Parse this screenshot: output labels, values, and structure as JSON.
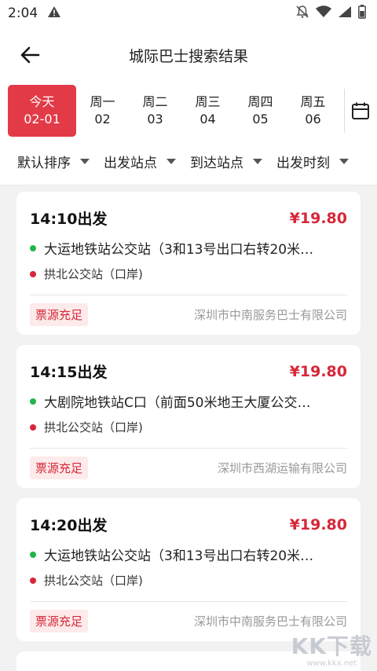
{
  "status_bar": {
    "time": "2:04"
  },
  "header": {
    "title": "城际巴士搜索结果"
  },
  "date_tabs": [
    {
      "day": "今天",
      "date": "02-01",
      "active": true
    },
    {
      "day": "周一",
      "date": "02"
    },
    {
      "day": "周二",
      "date": "03"
    },
    {
      "day": "周三",
      "date": "04"
    },
    {
      "day": "周四",
      "date": "05"
    },
    {
      "day": "周五",
      "date": "06"
    }
  ],
  "filters": [
    "默认排序",
    "出发站点",
    "到达站点",
    "出发时刻"
  ],
  "trips": [
    {
      "depart": "14:10出发",
      "price": "¥19.80",
      "origin": "大运地铁站公交站（3和13号出口右转20米…",
      "destination": "拱北公交站（口岸)",
      "status": "票源充足",
      "company": "深圳市中南服务巴士有限公司"
    },
    {
      "depart": "14:15出发",
      "price": "¥19.80",
      "origin": "大剧院地铁站C口（前面50米地王大厦公交…",
      "destination": "拱北公交站（口岸)",
      "status": "票源充足",
      "company": "深圳市西湖运输有限公司"
    },
    {
      "depart": "14:20出发",
      "price": "¥19.80",
      "origin": "大运地铁站公交站（3和13号出口右转20米…",
      "destination": "拱北公交站（口岸)",
      "status": "票源充足",
      "company": "深圳市中南服务巴士有限公司"
    }
  ],
  "watermark": {
    "logo": "KK下载",
    "url": "www.kkx.net"
  },
  "colors": {
    "accent": "#e33a47",
    "price": "#d7273a",
    "origin_dot": "#21b54b"
  }
}
